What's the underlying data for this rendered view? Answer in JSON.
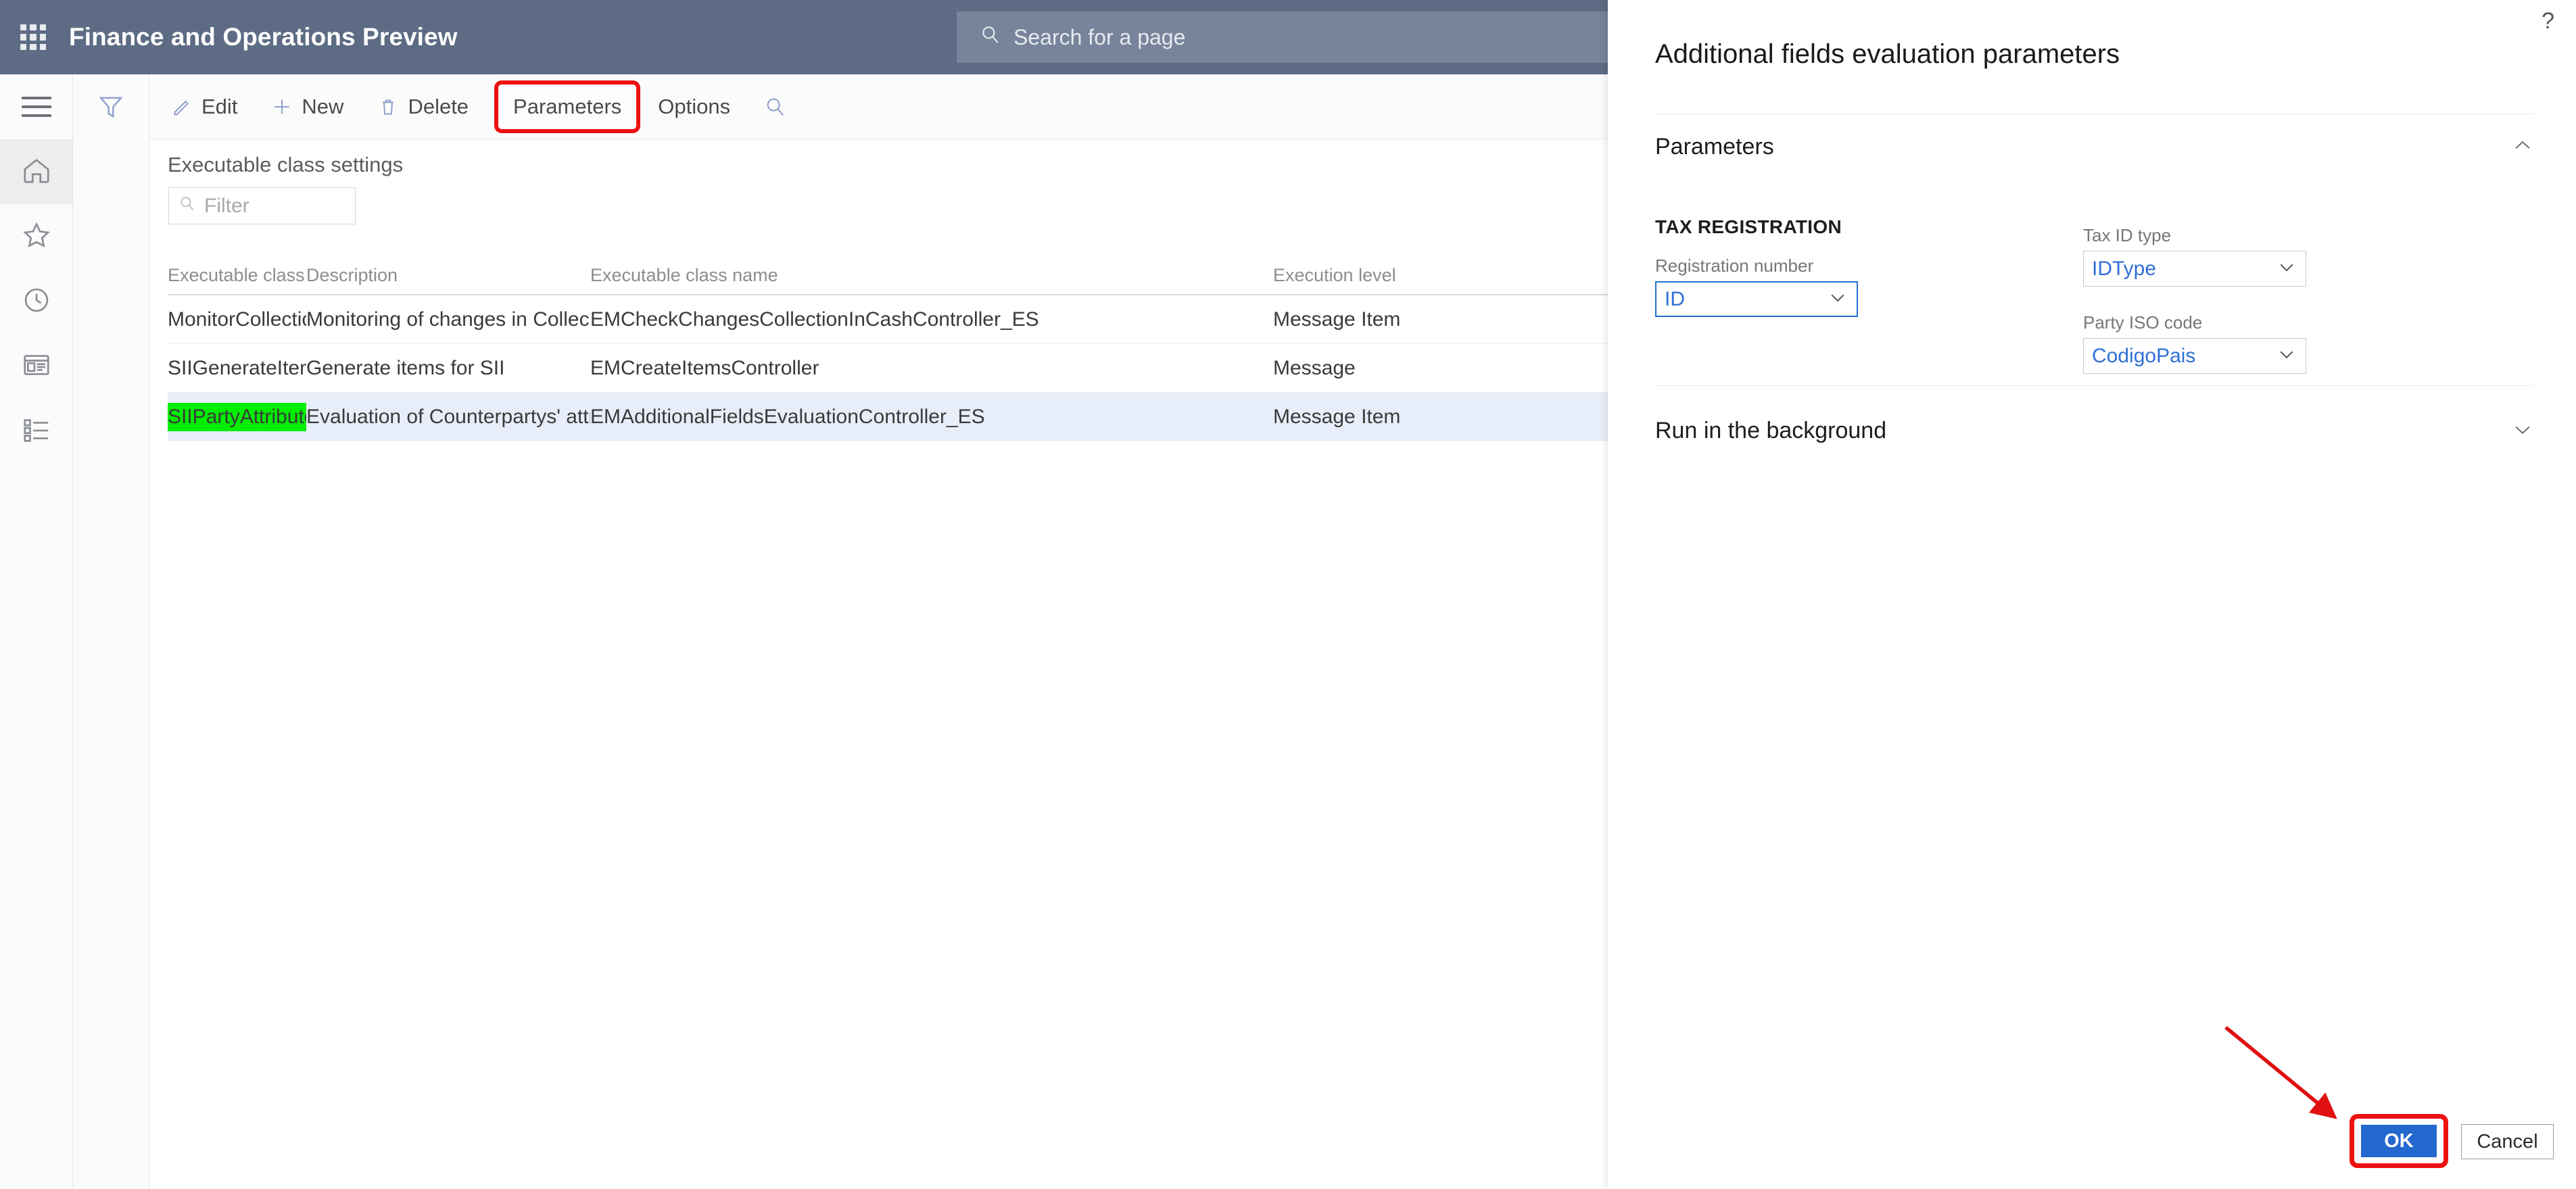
{
  "topnav": {
    "waffle_icon": "app-launcher-icon",
    "title": "Finance and Operations Preview",
    "search": {
      "icon": "search-icon",
      "placeholder": "Search for a page"
    },
    "help_icon": "help-icon",
    "help_glyph": "?"
  },
  "rail": {
    "items": [
      {
        "icon": "hamburger-menu-icon",
        "name": "navigation-menu"
      },
      {
        "icon": "home-icon",
        "name": "home"
      },
      {
        "icon": "star-icon",
        "name": "favorites"
      },
      {
        "icon": "clock-icon",
        "name": "recent"
      },
      {
        "icon": "workspace-icon",
        "name": "workspaces"
      },
      {
        "icon": "list-icon",
        "name": "modules"
      }
    ]
  },
  "filter_rail": {
    "icon": "funnel-filter-icon"
  },
  "commandbar": {
    "items": [
      {
        "label": "Edit",
        "icon": "pencil-edit-icon",
        "highlighted": false
      },
      {
        "label": "New",
        "icon": "plus-new-icon",
        "highlighted": false
      },
      {
        "label": "Delete",
        "icon": "trash-delete-icon",
        "highlighted": false
      },
      {
        "label": "Parameters",
        "icon": "",
        "highlighted": true
      },
      {
        "label": "Options",
        "icon": "",
        "highlighted": false
      }
    ],
    "search_icon": "search-icon"
  },
  "page": {
    "heading": "Executable class settings",
    "quick_filter": {
      "icon": "search-icon",
      "placeholder": "Filter",
      "value": ""
    }
  },
  "grid": {
    "columns": [
      "Executable class",
      "Description",
      "Executable class name",
      "Execution level"
    ],
    "rows": [
      {
        "executable_class": "MonitorCollectionInCash",
        "description": "Monitoring of changes in Collec...",
        "executable_class_name": "EMCheckChangesCollectionInCashController_ES",
        "execution_level": "Message Item",
        "selected": false,
        "marked": false
      },
      {
        "executable_class": "SIIGenerateItems",
        "description": "Generate items for SII",
        "executable_class_name": "EMCreateItemsController",
        "execution_level": "Message",
        "selected": false,
        "marked": false
      },
      {
        "executable_class": "SIIPartyAttributesEvaluation",
        "description": "Evaluation of Counterpartys' attr...",
        "executable_class_name": "EMAdditionalFieldsEvaluationController_ES",
        "execution_level": "Message Item",
        "selected": true,
        "marked": true
      }
    ]
  },
  "dialog": {
    "title": "Additional fields evaluation parameters",
    "sections": [
      {
        "title": "Parameters",
        "expanded": true,
        "chevron": "chevron-up-icon"
      },
      {
        "title": "Run in the background",
        "expanded": false,
        "chevron": "chevron-down-icon"
      }
    ],
    "group_label": "TAX REGISTRATION",
    "fields": [
      {
        "label": "Registration number",
        "value": "ID",
        "focused": true,
        "chevron": "chevron-down-icon"
      },
      {
        "label": "Tax ID type",
        "value": "IDType",
        "focused": false,
        "chevron": "chevron-down-icon"
      },
      {
        "label": "Party ISO code",
        "value": "CodigoPais",
        "focused": false,
        "chevron": "chevron-down-icon"
      }
    ],
    "ok_label": "OK",
    "cancel_label": "Cancel"
  },
  "annotations": {
    "arrow_icon": "red-arrow-pointer",
    "highlight_color": "#ee1111",
    "marker_color": "#00ee00"
  }
}
